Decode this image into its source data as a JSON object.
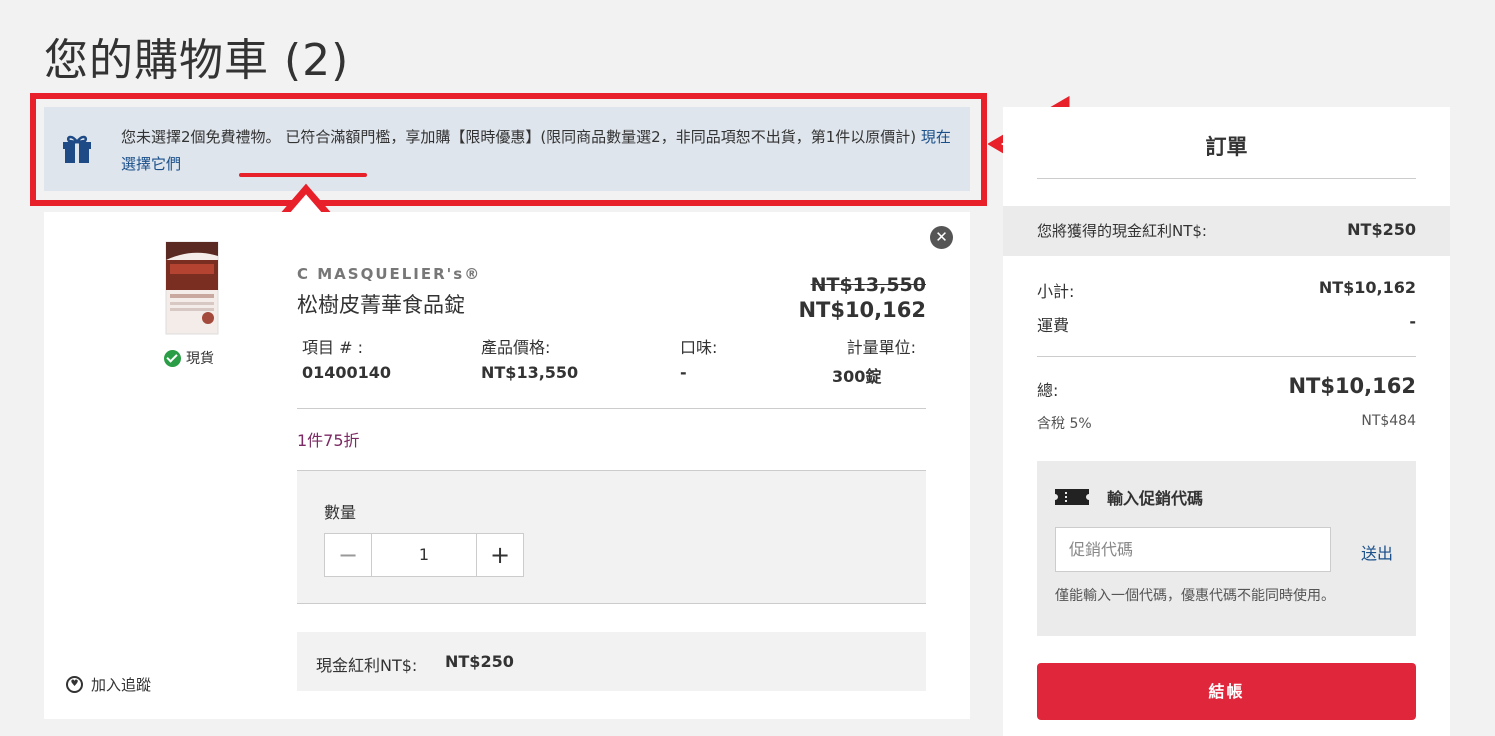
{
  "page": {
    "title": "您的購物車 (2)"
  },
  "gift_banner": {
    "message": "您未選擇2個免費禮物。 已符合滿額門檻，享加購【限時優惠】(限同商品數量選2，非同品項恕不出貨，第1件以原價計) ",
    "link": "現在選擇它們"
  },
  "product": {
    "brand": "C MASQUELIER's®",
    "name": "松樹皮菁華食品錠",
    "stock": "現貨",
    "price_original": "NT$13,550",
    "price_current": "NT$10,162",
    "attributes": {
      "item_label": "項目 # :",
      "item_value": "01400140",
      "price_label": "產品價格:",
      "price_value": "NT$13,550",
      "flavor_label": "口味:",
      "flavor_value": "-",
      "unit_label": "計量單位:",
      "unit_value": "300錠"
    },
    "promo": "1件75折",
    "quantity_label": "數量",
    "quantity": "1",
    "reward_label": "現金紅利NT$:",
    "reward_value": "NT$250",
    "wishlist": "加入追蹤"
  },
  "order": {
    "title": "訂單",
    "cash_reward_label": "您將獲得的現金紅利NT$:",
    "cash_reward_value": "NT$250",
    "subtotal_label": "小計:",
    "subtotal_value": "NT$10,162",
    "shipping_label": "運費",
    "shipping_value": "-",
    "total_label": "總:",
    "total_value": "NT$10,162",
    "tax_label": "含稅 5%",
    "tax_value": "NT$484",
    "coupon_title": "輸入促銷代碼",
    "coupon_placeholder": "促銷代碼",
    "coupon_submit": "送出",
    "coupon_note": "僅能輸入一個代碼，優惠代碼不能同時使用。",
    "checkout": "結帳"
  },
  "colors": {
    "accent": "#e0263a",
    "annotation": "#e8202a",
    "link": "#1a4f8a",
    "banner": "#dfe5ec"
  }
}
